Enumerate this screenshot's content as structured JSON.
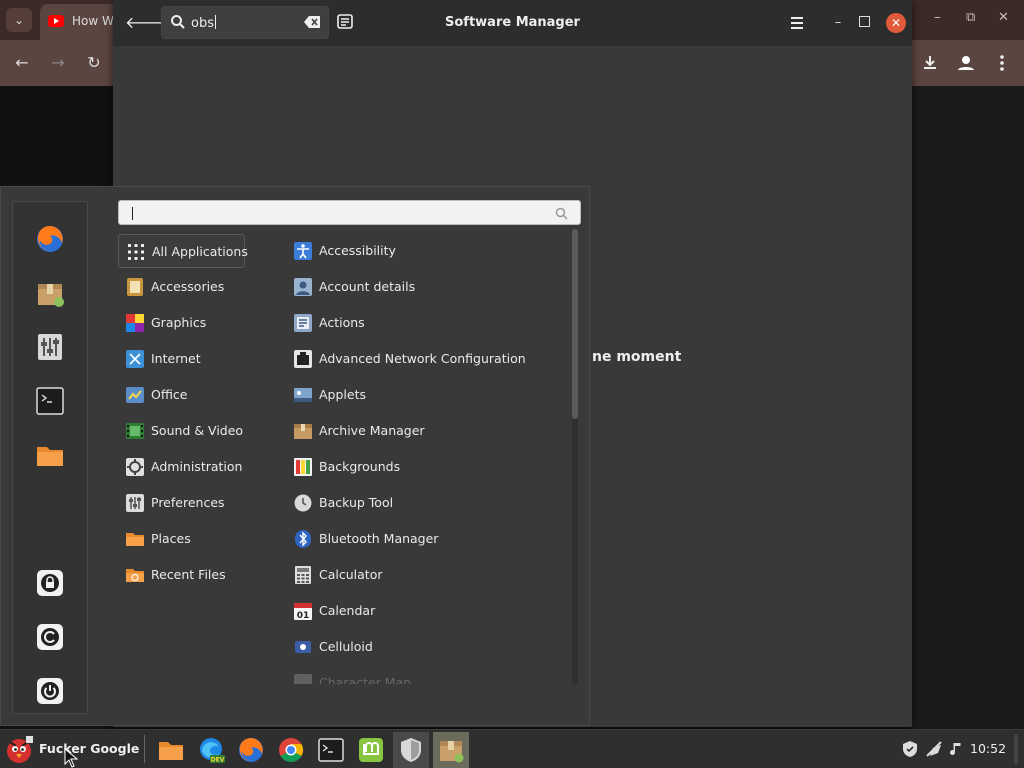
{
  "browser": {
    "tab_title": "How W",
    "window_controls": [
      "–",
      "⧉",
      "✕"
    ]
  },
  "software_manager": {
    "title": "Software Manager",
    "search_value": "obs",
    "status_text": "ne moment"
  },
  "menu": {
    "search_value": "",
    "favorites": [
      {
        "name": "firefox",
        "icon": "firefox-icon"
      },
      {
        "name": "software-manager",
        "icon": "package-icon"
      },
      {
        "name": "system-settings",
        "icon": "sliders-icon"
      },
      {
        "name": "terminal",
        "icon": "terminal-icon"
      },
      {
        "name": "files",
        "icon": "folder-icon"
      },
      {
        "name": "lock-screen",
        "icon": "lock-icon"
      },
      {
        "name": "logout",
        "icon": "logout-icon"
      },
      {
        "name": "quit",
        "icon": "power-icon"
      }
    ],
    "categories": [
      {
        "label": "All Applications",
        "icon": "grid-icon",
        "selected": true
      },
      {
        "label": "Accessories",
        "icon": "calculator-icon"
      },
      {
        "label": "Graphics",
        "icon": "graphics-icon"
      },
      {
        "label": "Internet",
        "icon": "internet-icon"
      },
      {
        "label": "Office",
        "icon": "office-icon"
      },
      {
        "label": "Sound & Video",
        "icon": "media-icon"
      },
      {
        "label": "Administration",
        "icon": "admin-icon"
      },
      {
        "label": "Preferences",
        "icon": "preferences-icon"
      },
      {
        "label": "Places",
        "icon": "folder-icon"
      },
      {
        "label": "Recent Files",
        "icon": "recent-icon"
      }
    ],
    "applications": [
      {
        "label": "Accessibility",
        "icon": "accessibility-icon"
      },
      {
        "label": "Account details",
        "icon": "account-icon"
      },
      {
        "label": "Actions",
        "icon": "actions-icon"
      },
      {
        "label": "Advanced Network Configuration",
        "icon": "network-icon"
      },
      {
        "label": "Applets",
        "icon": "applets-icon"
      },
      {
        "label": "Archive Manager",
        "icon": "archive-icon"
      },
      {
        "label": "Backgrounds",
        "icon": "backgrounds-icon"
      },
      {
        "label": "Backup Tool",
        "icon": "backup-icon"
      },
      {
        "label": "Bluetooth Manager",
        "icon": "bluetooth-icon"
      },
      {
        "label": "Calculator",
        "icon": "calculator-icon"
      },
      {
        "label": "Calendar",
        "icon": "calendar-icon"
      },
      {
        "label": "Celluloid",
        "icon": "celluloid-icon"
      },
      {
        "label": "Character Map",
        "icon": "charmap-icon",
        "faded": true
      }
    ]
  },
  "panel": {
    "menu_label": "Fucker Google",
    "clock": "10:52",
    "launchers": [
      "files",
      "edge-dev",
      "firefox",
      "chrome",
      "terminal",
      "mint-install",
      "shield",
      "software-manager"
    ]
  },
  "colors": {
    "menu_bg": "#393939",
    "header_bg": "#2d2d2d",
    "close_button": "#e25a3a",
    "browser_tab_bar": "#3b2a27"
  }
}
